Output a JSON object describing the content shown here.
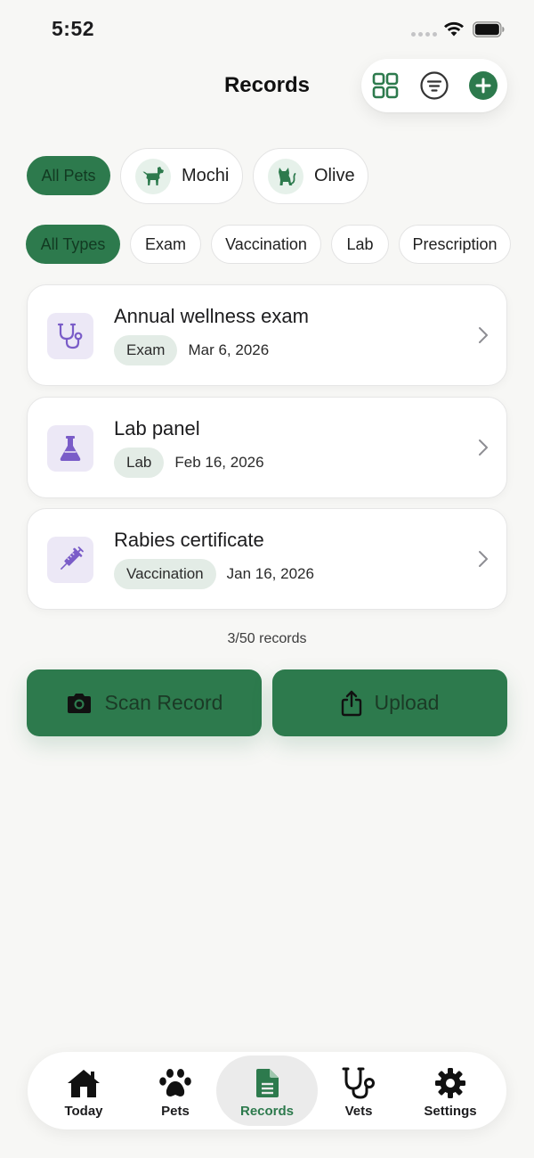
{
  "status_bar": {
    "time": "5:52"
  },
  "header": {
    "title": "Records",
    "actions": [
      "grid-view",
      "filter",
      "add"
    ]
  },
  "pet_filters": [
    {
      "label": "All Pets",
      "selected": true
    },
    {
      "label": "Mochi",
      "icon": "dog-icon",
      "selected": false
    },
    {
      "label": "Olive",
      "icon": "cat-icon",
      "selected": false
    }
  ],
  "type_filters": [
    {
      "label": "All Types",
      "selected": true
    },
    {
      "label": "Exam",
      "selected": false
    },
    {
      "label": "Vaccination",
      "selected": false
    },
    {
      "label": "Lab",
      "selected": false
    },
    {
      "label": "Prescription",
      "selected": false
    }
  ],
  "records": [
    {
      "title": "Annual wellness exam",
      "type": "Exam",
      "date": "Mar 6, 2026",
      "icon": "stethoscope-icon"
    },
    {
      "title": "Lab panel",
      "type": "Lab",
      "date": "Feb 16, 2026",
      "icon": "flask-icon"
    },
    {
      "title": "Rabies certificate",
      "type": "Vaccination",
      "date": "Jan 16, 2026",
      "icon": "syringe-icon"
    }
  ],
  "records_count": "3/50 records",
  "actions": {
    "scan_label": "Scan Record",
    "upload_label": "Upload"
  },
  "tab_bar": {
    "items": [
      {
        "label": "Today",
        "icon": "house-icon"
      },
      {
        "label": "Pets",
        "icon": "paw-icon"
      },
      {
        "label": "Records",
        "icon": "document-icon",
        "active": true
      },
      {
        "label": "Vets",
        "icon": "stethoscope-icon"
      },
      {
        "label": "Settings",
        "icon": "gear-icon"
      }
    ]
  },
  "colors": {
    "accent": "#2d7a4d",
    "background": "#f7f7f5",
    "record_icon_bg": "#ece8f6",
    "record_icon": "#7a5cc8",
    "tag_bg": "#e3ece6"
  }
}
